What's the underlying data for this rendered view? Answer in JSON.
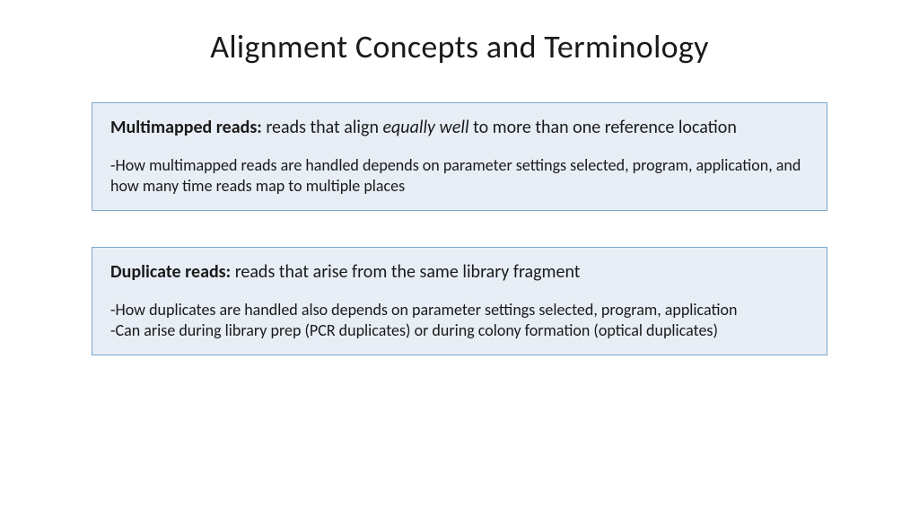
{
  "slide": {
    "title": "Alignment Concepts and Terminology",
    "box1": {
      "term": "Multimapped reads:",
      "def_part1": "  reads that align ",
      "def_italic": "equally well",
      "def_part2": " to more than one reference location",
      "detail1": "-How multimapped reads are handled depends on parameter settings selected, program, application, and how many time reads map to multiple places"
    },
    "box2": {
      "term": "Duplicate reads:",
      "def_part1": "  reads that arise from the same library fragment",
      "detail1": "-How duplicates are handled also depends on parameter settings selected, program, application",
      "detail2": "-Can arise during library prep (PCR duplicates) or during colony formation (optical duplicates)"
    }
  }
}
